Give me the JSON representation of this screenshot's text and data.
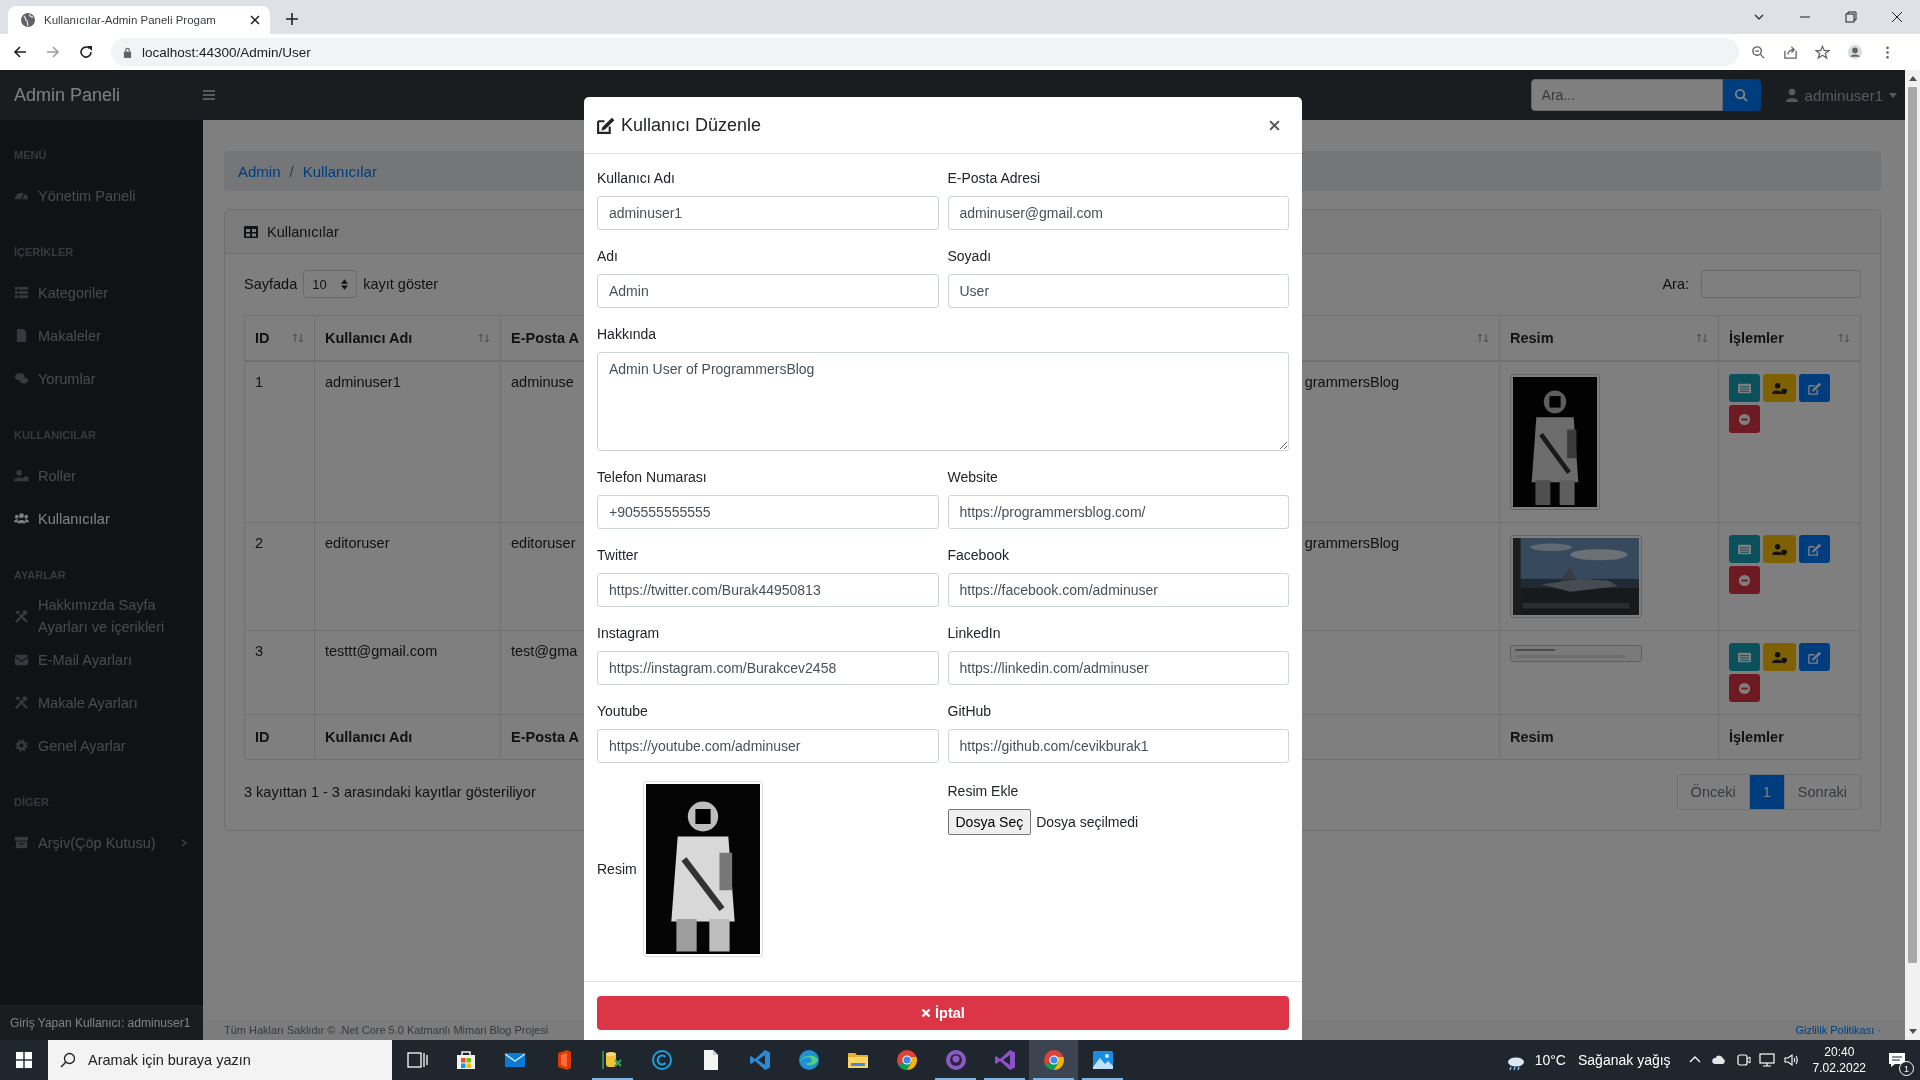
{
  "browser": {
    "tab_title": "Kullanıcılar-Admin Paneli Progam",
    "address": "localhost:44300/Admin/User"
  },
  "navbar": {
    "brand": "Admin Paneli",
    "search": {
      "placeholder": "Ara..."
    },
    "user": "adminuser1"
  },
  "sidebar": {
    "sections": [
      {
        "heading": "MENÜ",
        "items": [
          {
            "label": "Yönetim Paneli",
            "kind": "gauge",
            "selected": false
          }
        ]
      },
      {
        "heading": "İÇERİKLER",
        "items": [
          {
            "label": "Kategoriler",
            "kind": "list",
            "selected": false
          },
          {
            "label": "Makaleler",
            "kind": "file",
            "selected": false
          },
          {
            "label": "Yorumlar",
            "kind": "comments",
            "selected": false
          }
        ]
      },
      {
        "heading": "KULLANICILAR",
        "items": [
          {
            "label": "Roller",
            "kind": "roles",
            "selected": false
          },
          {
            "label": "Kullanıcılar",
            "kind": "users",
            "selected": true
          }
        ]
      },
      {
        "heading": "AYARLAR",
        "items": [
          {
            "label": "Hakkımızda Sayfa Ayarları ve içerikleri",
            "kind": "tools",
            "selected": false
          },
          {
            "label": "E-Mail Ayarları",
            "kind": "mail",
            "selected": false
          },
          {
            "label": "Makale Ayarları",
            "kind": "tools",
            "selected": false
          },
          {
            "label": "Genel Ayarlar",
            "kind": "gear",
            "selected": false
          }
        ]
      },
      {
        "heading": "DİGER",
        "items": [
          {
            "label": "Arşiv(Çöp Kutusu)",
            "kind": "archive",
            "selected": false,
            "expanded": false
          }
        ]
      }
    ],
    "footer": "Giriş Yapan Kullanıcı: adminuser1"
  },
  "content": {
    "breadcrumb": {
      "items": [
        "Admin",
        "Kullanıcılar"
      ],
      "separator": "/"
    },
    "card_title": "Kullanıcılar",
    "length": {
      "prefix": "Sayfada",
      "value": "10",
      "suffix": "kayıt göster"
    },
    "search_label": "Ara:",
    "table": {
      "columns": [
        "ID",
        "Kullanıcı Adı",
        "E-Posta A",
        "Resim",
        "İşlemler"
      ],
      "rows": [
        {
          "id": "1",
          "username": "adminuser1",
          "email": "adminuse",
          "column_4": "grammersBlog"
        },
        {
          "id": "2",
          "username": "editoruser",
          "email": "editoruser",
          "column_4": "grammersBlog"
        },
        {
          "id": "3",
          "username": "testtt@gmail.com",
          "email": "test@gma"
        }
      ],
      "footer": [
        "ID",
        "Kullanıcı Adı",
        "E-Posta A",
        "Resim",
        "İşlemler"
      ]
    },
    "info": "3 kayıttan 1 - 3 arasındaki kayıtlar gösteriliyor",
    "pagination": [
      {
        "label": "Önceki",
        "selected": false
      },
      {
        "label": "1",
        "selected": true
      },
      {
        "label": "Sonraki",
        "selected": false
      }
    ]
  },
  "footer": {
    "copyright": "Tüm Hakları Saklıdır © .Net Core 5.0 Katmanlı Mimari Blog Projesi",
    "link": "Gizlilik Politikası ·"
  },
  "modal": {
    "title": "Kullanıcı Düzenle",
    "rows": [
      {
        "fields": [
          {
            "label": "Kullanıcı Adı",
            "value": "adminuser1",
            "kind": "input"
          },
          {
            "label": "E-Posta Adresi",
            "value": "adminuser@gmail.com",
            "kind": "input"
          }
        ]
      },
      {
        "fields": [
          {
            "label": "Adı",
            "value": "Admin",
            "kind": "input"
          },
          {
            "label": "Soyadı",
            "value": "User",
            "kind": "input"
          }
        ]
      },
      {
        "fields": [
          {
            "label": "Hakkında",
            "value": "Admin User of ProgrammersBlog",
            "kind": "textarea"
          }
        ]
      },
      {
        "fields": [
          {
            "label": "Telefon Numarası",
            "value": "+905555555555",
            "kind": "input"
          },
          {
            "label": "Website",
            "value": "https://programmersblog.com/",
            "kind": "input"
          }
        ]
      },
      {
        "fields": [
          {
            "label": "Twitter",
            "value": "https://twitter.com/Burak44950813",
            "kind": "input"
          },
          {
            "label": "Facebook",
            "value": "https://facebook.com/adminuser",
            "kind": "input"
          }
        ]
      },
      {
        "fields": [
          {
            "label": "Instagram",
            "value": "https://instagram.com/Burakcev2458",
            "kind": "input"
          },
          {
            "label": "LinkedIn",
            "value": "https://linkedin.com/adminuser",
            "kind": "input"
          }
        ]
      },
      {
        "fields": [
          {
            "label": "Youtube",
            "value": "https://youtube.com/adminuser",
            "kind": "input"
          },
          {
            "label": "GitHub",
            "value": "https://github.com/cevikburak1",
            "kind": "input"
          }
        ]
      }
    ],
    "image": {
      "label": "Resim"
    },
    "upload": {
      "label": "Resim Ekle",
      "button": "Dosya Seç",
      "status": "Dosya seçilmedi"
    },
    "cancel": "İptal"
  },
  "taskbar": {
    "search": {
      "placeholder": "Aramak için buraya yazın"
    },
    "apps": [
      {
        "kind": "taskview",
        "running": false,
        "selected": false
      },
      {
        "kind": "store",
        "running": false,
        "selected": false
      },
      {
        "kind": "mail",
        "running": false,
        "selected": false
      },
      {
        "kind": "office",
        "running": false,
        "selected": false
      },
      {
        "kind": "database",
        "running": true,
        "selected": false
      },
      {
        "kind": "ring",
        "running": false,
        "selected": false
      },
      {
        "kind": "document",
        "running": false,
        "selected": false
      },
      {
        "kind": "editor",
        "running": false,
        "selected": false
      },
      {
        "kind": "edge",
        "running": false,
        "selected": false
      },
      {
        "kind": "folder",
        "running": false,
        "selected": false
      },
      {
        "kind": "chrome",
        "running": false,
        "selected": false
      },
      {
        "kind": "github",
        "running": true,
        "selected": false
      },
      {
        "kind": "studio",
        "running": true,
        "selected": false
      },
      {
        "kind": "chrome",
        "running": true,
        "selected": true
      },
      {
        "kind": "photos",
        "running": true,
        "selected": false
      }
    ],
    "weather": {
      "temperature": "10°C",
      "condition": "Sağanak yağış"
    },
    "time": "20:40",
    "date": "7.02.2022",
    "notifications": "1"
  }
}
